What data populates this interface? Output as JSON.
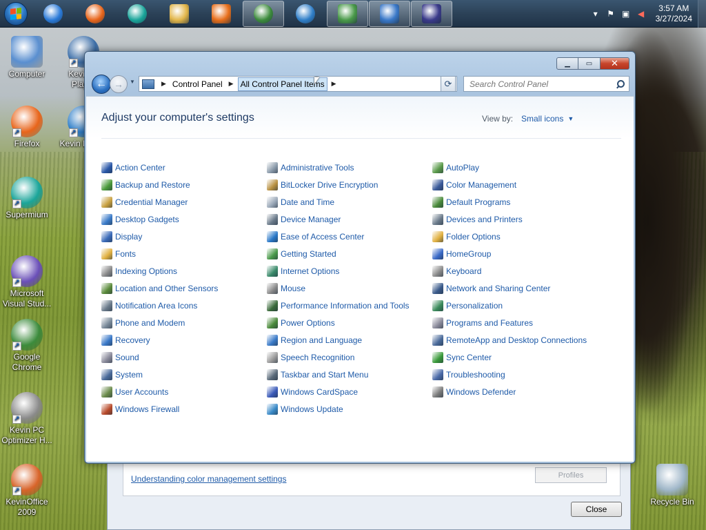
{
  "taskbar": {
    "clock_time": "3:57 AM",
    "clock_date": "3/27/2024",
    "buttons": [
      {
        "name": "ie",
        "color": "#2a7ad8"
      },
      {
        "name": "firefox",
        "color": "#e8651b"
      },
      {
        "name": "supermium",
        "color": "#1aa59a"
      },
      {
        "name": "explorer",
        "color": "#e2b64a"
      },
      {
        "name": "media",
        "color": "#e86f1b"
      },
      {
        "name": "chrome",
        "color": "#3c8b3c"
      },
      {
        "name": "globe",
        "color": "#2f7ec8"
      },
      {
        "name": "download",
        "color": "#4a9a4a"
      },
      {
        "name": "control-panel",
        "color": "#3a78c8"
      },
      {
        "name": "display",
        "color": "#3a3a8a"
      }
    ]
  },
  "desktop": {
    "icons": [
      {
        "label": "Computer",
        "color": "#5a8fd0"
      },
      {
        "label": "Kevin M Player",
        "color": "#3c6ea8"
      },
      {
        "label": "Firefox",
        "color": "#e8651b"
      },
      {
        "label": "Kevin Br 201",
        "color": "#2f7ec8"
      },
      {
        "label": "Supermium",
        "color": "#1aa59a"
      },
      {
        "label": "Microsoft Visual Stud...",
        "color": "#6a4fb8"
      },
      {
        "label": "Google Chrome",
        "color": "#3c8b3c"
      },
      {
        "label": "Kevin PC Optimizer H...",
        "color": "#8a8a8a"
      },
      {
        "label": "KevinOffice 2009",
        "color": "#d8642a"
      },
      {
        "label": "Recycle Bin",
        "color": "#9fb6c8"
      }
    ]
  },
  "bg_dialog": {
    "link": "Understanding color management settings",
    "profiles": "Profiles",
    "close": "Close"
  },
  "window": {
    "breadcrumb": [
      "Control Panel",
      "All Control Panel Items"
    ],
    "search_placeholder": "Search Control Panel",
    "heading": "Adjust your computer's settings",
    "view_by_label": "View by:",
    "view_by_value": "Small icons",
    "columns": [
      [
        {
          "label": "Action Center",
          "color": "#2a58a8"
        },
        {
          "label": "Backup and Restore",
          "color": "#4a9a3a"
        },
        {
          "label": "Credential Manager",
          "color": "#c8a040"
        },
        {
          "label": "Desktop Gadgets",
          "color": "#3a7ac8"
        },
        {
          "label": "Display",
          "color": "#3a6ab8"
        },
        {
          "label": "Fonts",
          "color": "#e0b040"
        },
        {
          "label": "Indexing Options",
          "color": "#8a8a8a"
        },
        {
          "label": "Location and Other Sensors",
          "color": "#5a8a3a"
        },
        {
          "label": "Notification Area Icons",
          "color": "#6a7a8a"
        },
        {
          "label": "Phone and Modem",
          "color": "#7a8a9a"
        },
        {
          "label": "Recovery",
          "color": "#3a78c8"
        },
        {
          "label": "Sound",
          "color": "#8a8a9a"
        },
        {
          "label": "System",
          "color": "#4a6a9a"
        },
        {
          "label": "User Accounts",
          "color": "#6a8a4a"
        },
        {
          "label": "Windows Firewall",
          "color": "#b84a2a"
        }
      ],
      [
        {
          "label": "Administrative Tools",
          "color": "#8a9aaa"
        },
        {
          "label": "BitLocker Drive Encryption",
          "color": "#b89040"
        },
        {
          "label": "Date and Time",
          "color": "#9aa8b8"
        },
        {
          "label": "Device Manager",
          "color": "#6a7a8a"
        },
        {
          "label": "Ease of Access Center",
          "color": "#2a78c8"
        },
        {
          "label": "Getting Started",
          "color": "#4a9a4a"
        },
        {
          "label": "Internet Options",
          "color": "#3a8a6a"
        },
        {
          "label": "Mouse",
          "color": "#8a8a8a"
        },
        {
          "label": "Performance Information and Tools",
          "color": "#3a6a3a"
        },
        {
          "label": "Power Options",
          "color": "#4a8a3a"
        },
        {
          "label": "Region and Language",
          "color": "#3a7ac8"
        },
        {
          "label": "Speech Recognition",
          "color": "#9a9a9a"
        },
        {
          "label": "Taskbar and Start Menu",
          "color": "#5a6a7a"
        },
        {
          "label": "Windows CardSpace",
          "color": "#3a5ab8"
        },
        {
          "label": "Windows Update",
          "color": "#3a8ac8"
        }
      ],
      [
        {
          "label": "AutoPlay",
          "color": "#5a9a4a"
        },
        {
          "label": "Color Management",
          "color": "#3a5a9a"
        },
        {
          "label": "Default Programs",
          "color": "#4a8a3a"
        },
        {
          "label": "Devices and Printers",
          "color": "#6a7a8a"
        },
        {
          "label": "Folder Options",
          "color": "#e0b040"
        },
        {
          "label": "HomeGroup",
          "color": "#3a6ac8"
        },
        {
          "label": "Keyboard",
          "color": "#8a8a8a"
        },
        {
          "label": "Network and Sharing Center",
          "color": "#3a5a8a"
        },
        {
          "label": "Personalization",
          "color": "#3a8a5a"
        },
        {
          "label": "Programs and Features",
          "color": "#8a8a9a"
        },
        {
          "label": "RemoteApp and Desktop Connections",
          "color": "#4a6a9a"
        },
        {
          "label": "Sync Center",
          "color": "#3a9a3a"
        },
        {
          "label": "Troubleshooting",
          "color": "#4a6aa8"
        },
        {
          "label": "Windows Defender",
          "color": "#7a7a7a"
        }
      ]
    ]
  }
}
